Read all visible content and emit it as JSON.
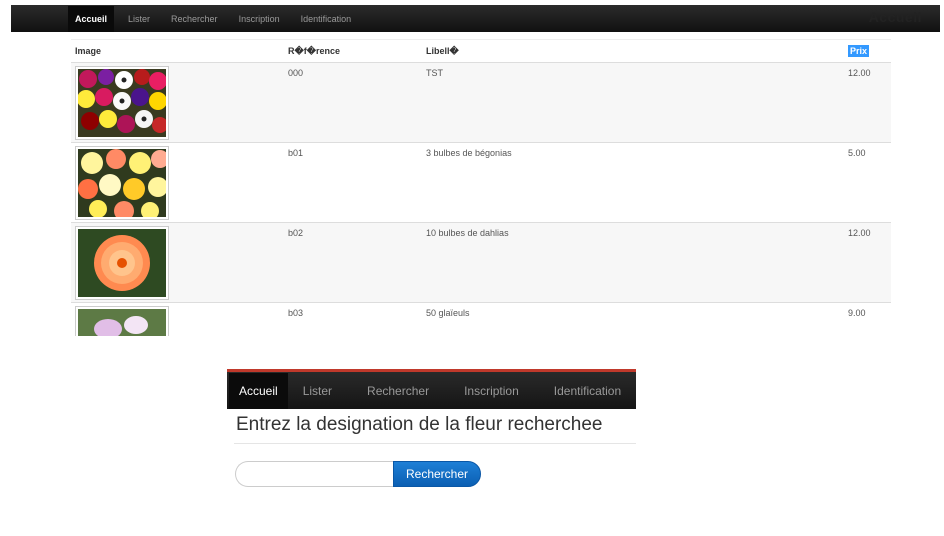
{
  "top_nav": {
    "items": [
      "Accueil",
      "Lister",
      "Rechercher",
      "Inscription",
      "Identification"
    ],
    "active": "Accueil",
    "brand": "Accueil"
  },
  "table": {
    "headers": {
      "image": "Image",
      "reference": "R�f�rence",
      "libelle": "Libell�",
      "prix": "Prix"
    },
    "rows": [
      {
        "reference": "000",
        "libelle": "TST",
        "prix": "12.00",
        "image_icon": "pansies-photo"
      },
      {
        "reference": "b01",
        "libelle": "3 bulbes de bégonias",
        "prix": "5.00",
        "image_icon": "begonias-photo"
      },
      {
        "reference": "b02",
        "libelle": "10 bulbes de dahlias",
        "prix": "12.00",
        "image_icon": "dahlia-photo"
      },
      {
        "reference": "b03",
        "libelle": "50 glaïeuls",
        "prix": "9.00",
        "image_icon": "gladiolus-photo"
      }
    ]
  },
  "search_panel": {
    "nav_items": [
      "Accueil",
      "Lister",
      "Rechercher",
      "Inscription",
      "Identification"
    ],
    "title": "Entrez la designation de la fleur recherchee",
    "input_value": "",
    "button_label": "Rechercher",
    "accent_color": "#c0392b",
    "button_color": "#0b5fb3"
  }
}
